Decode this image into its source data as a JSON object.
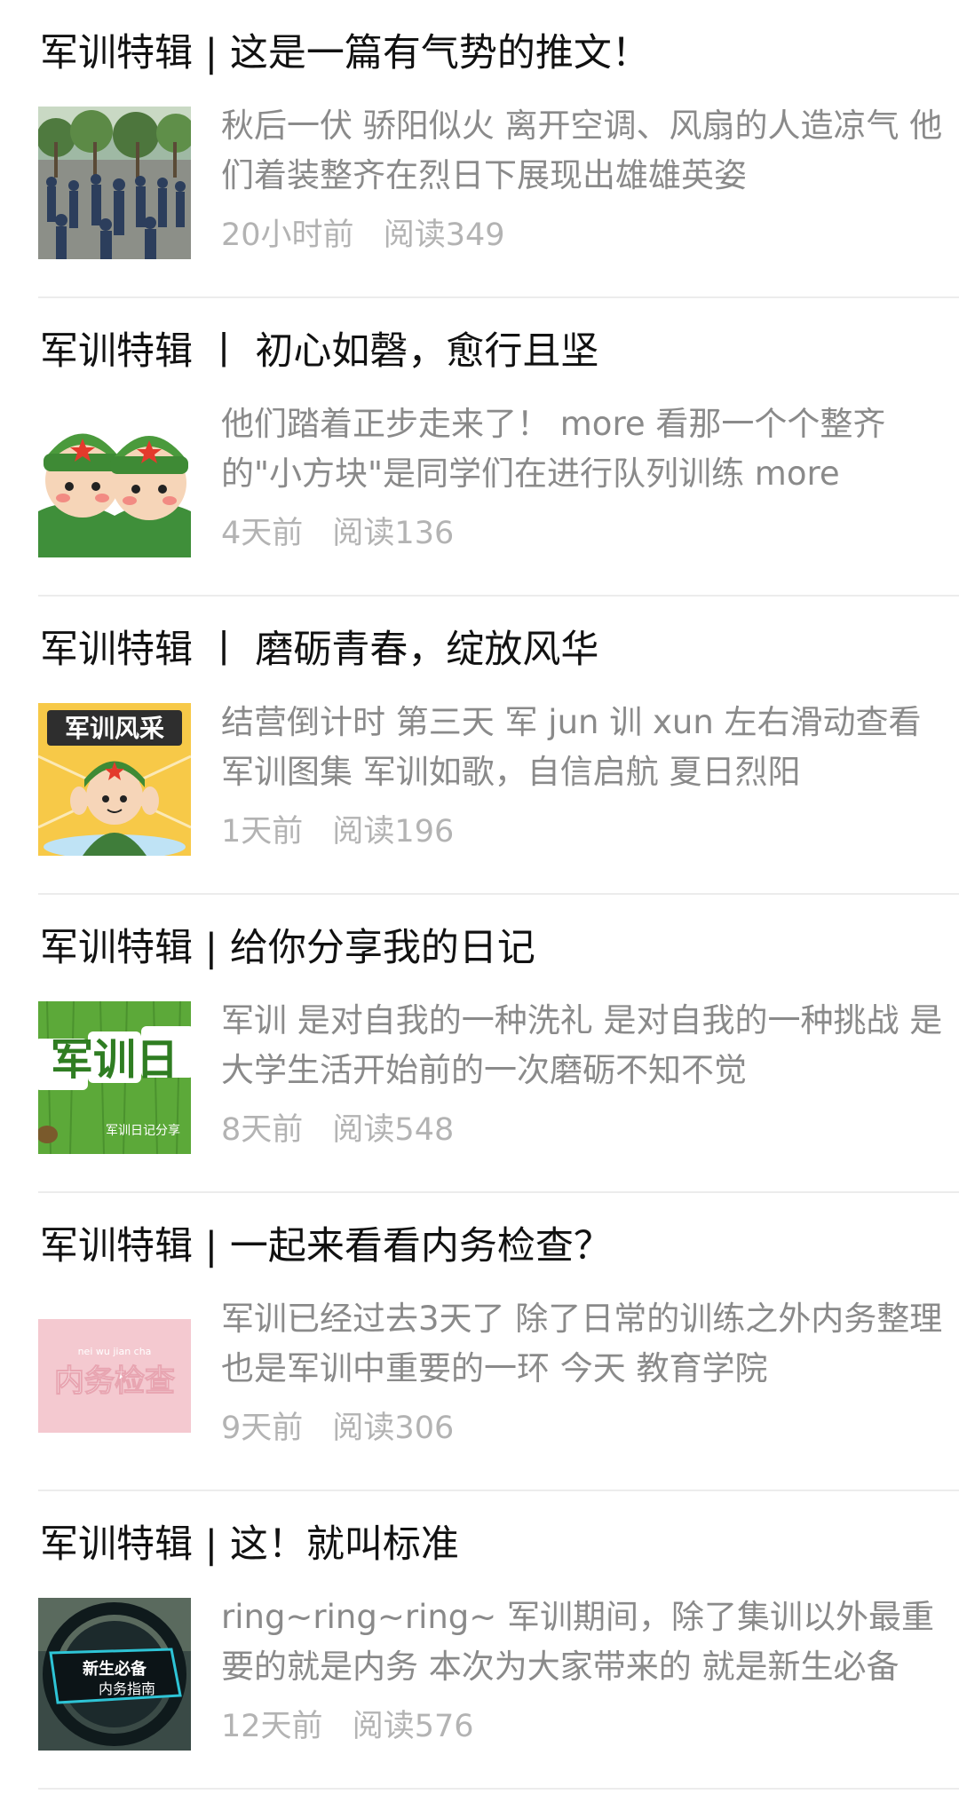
{
  "articles": [
    {
      "title": "军训特辑 | 这是一篇有气势的推文！",
      "summary": "秋后一伏 骄阳似火 离开空调、风扇的人造凉气 他们着装整齐在烈日下展现出雄雄英姿",
      "time": "20小时前",
      "reads": "阅读349",
      "thumb": {
        "icon": "training-field-photo-icon",
        "text": "",
        "subtext": ""
      }
    },
    {
      "title": "军训特辑 丨 初心如磬，愈行且坚",
      "summary": "他们踏着正步走来了！ more 看那一个个整齐的\"小方块\"是同学们在进行队列训练 more",
      "time": "4天前",
      "reads": "阅读136",
      "thumb": {
        "icon": "cartoon-soldiers-icon",
        "text": "",
        "subtext": ""
      }
    },
    {
      "title": "军训特辑 丨 磨砺青春，绽放风华",
      "summary": "结营倒计时 第三天 军 jun 训 xun 左右滑动查看军训图集 军训如歌，自信启航 夏日烈阳",
      "time": "1天前",
      "reads": "阅读196",
      "thumb": {
        "icon": "cartoon-soldier-salute-icon",
        "text": "军训风采",
        "subtext": ""
      }
    },
    {
      "title": "军训特辑 | 给你分享我的日记",
      "summary": "军训 是对自我的一种洗礼 是对自我的一种挑战 是大学生活开始前的一次磨砺不知不觉",
      "time": "8天前",
      "reads": "阅读548",
      "thumb": {
        "icon": "diary-grass-icon",
        "text": "军训日",
        "subtext": "军训日记分享"
      }
    },
    {
      "title": "军训特辑 | 一起来看看内务检查？",
      "summary": "军训已经过去3天了 除了日常的训练之外内务整理也是军训中重要的一环 今天 教育学院",
      "time": "9天前",
      "reads": "阅读306",
      "thumb": {
        "icon": "dorm-inspection-icon",
        "text": "内务检查",
        "subtext": "nei wu jian cha"
      }
    },
    {
      "title": "军训特辑 | 这！就叫标准",
      "summary": "ring~ring~ring~ 军训期间，除了集训以外最重要的就是内务 本次为大家带来的 就是新生必备",
      "time": "12天前",
      "reads": "阅读576",
      "thumb": {
        "icon": "freshman-guide-icon",
        "text": "新生必备",
        "subtext": "内务指南"
      }
    }
  ]
}
